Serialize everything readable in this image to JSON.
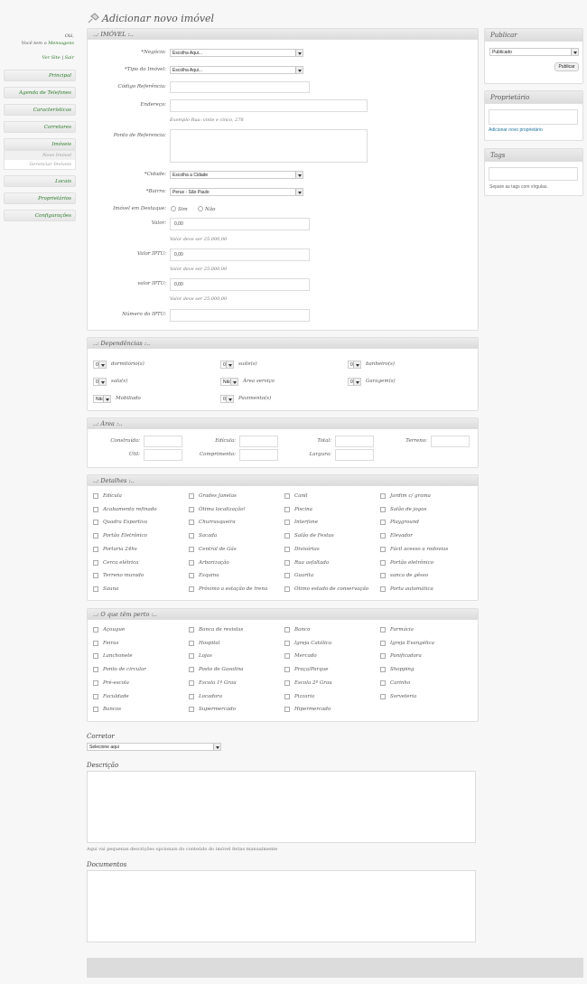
{
  "page_title": "Adicionar novo imóvel",
  "sidebar": {
    "greeting": "Olá,",
    "message_prefix": "Você tem o",
    "message_link": "Mensagens",
    "view_site": "Ver Site",
    "separator": "|",
    "logout": "Sair",
    "items": [
      {
        "label": "Principal"
      },
      {
        "label": "Agenda de Telefones"
      },
      {
        "label": "Características"
      },
      {
        "label": "Corretores"
      },
      {
        "label": "Imóveis"
      },
      {
        "label": "Locais"
      },
      {
        "label": "Proprietários"
      },
      {
        "label": "Configurações"
      }
    ],
    "submenu": [
      {
        "label": "Novo Imóvel"
      },
      {
        "label": "Gerenciar Imóveis"
      }
    ]
  },
  "imovel": {
    "header": "..: IMÓVEL :..",
    "negocio_label": "*Negócio:",
    "negocio_value": "Escolha Aqui...",
    "tipo_label": "*Tipo do Imóvel:",
    "tipo_value": "Escolha Aqui...",
    "codigo_label": "Código Referência:",
    "endereco_label": "Endereço:",
    "endereco_hint": "Exemplo Rua: vinte e cinco, 278",
    "ponto_label": "Ponto de Referencia:",
    "cidade_label": "*Cidade:",
    "cidade_value": "Escolha a Cidade",
    "bairro_label": "*Bairro:",
    "bairro_value": "Perus - São Paulo",
    "destaque_label": "Imóvel em Destaque:",
    "destaque_sim": "Sim",
    "destaque_nao": "Não",
    "valor_label": "Valor:",
    "valor_value": "0,00",
    "valor_hint": "Valor deve ser 25.000,00",
    "iptu_label": "Valor IPTU:",
    "iptu_value": "0,00",
    "iptu_hint": "Valor deve ser 25.000,00",
    "iptu2_label": "valor IPTU:",
    "iptu2_value": "0,00",
    "iptu2_hint": "Valor deve ser 25.000,00",
    "numero_iptu_label": "Número do IPTU:"
  },
  "dependencias": {
    "header": "..: Dependências :..",
    "items": [
      {
        "value": "0",
        "label": "dormitório(s)"
      },
      {
        "value": "0",
        "label": "suíte(s)"
      },
      {
        "value": "0",
        "label": "banheiro(s)"
      },
      {
        "value": "0",
        "label": "sala(s)"
      },
      {
        "value": "Não",
        "label": "Área serviço"
      },
      {
        "value": "0",
        "label": "Garagem(s)"
      },
      {
        "value": "Não",
        "label": "Mobiliado"
      },
      {
        "value": "0",
        "label": "Pavimento(s)"
      }
    ]
  },
  "area": {
    "header": "..: Área :..",
    "fields": [
      "Construída:",
      "Edícula:",
      "Total:",
      "Terreno:",
      "Útil:",
      "Comprimento:",
      "Largura:"
    ]
  },
  "detalhes": {
    "header": "..: Detalhes :..",
    "items": [
      "Edícula",
      "Grades Janelas",
      "Canil",
      "Jardim c/ grama",
      "Acabamento refinado",
      "Ótima localização!",
      "Piscina",
      "Salão de jogos",
      "Quadra Esportiva",
      "Churrasqueira",
      "Interfone",
      "Playground",
      "Portão Eletrônico",
      "Sacada",
      "Salão de Festas",
      "Elevador",
      "Portaria 24hs",
      "Central de Gás",
      "Divisórias",
      "Fácil acesso a rodovias",
      "Cerca elétrica",
      "Arborização",
      "Rua asfaltada",
      "Portão eletrônico",
      "Terreno murado",
      "Esquina",
      "Guarita",
      "sanca de gêsso",
      "Sauna",
      "Próximo a estação de trena",
      "Ótimo estado de conservação",
      "Porta automática"
    ]
  },
  "perto": {
    "header": "..: O que têm perto :..",
    "items": [
      "Açougue",
      "Banca de revistas",
      "Banco",
      "Farmácia",
      "Feiras",
      "Hospital",
      "Igreja Católica",
      "Igreja Evangélica",
      "Lanchonete",
      "Lojas",
      "Mercado",
      "Panificadora",
      "Ponto de circular",
      "Posto de Gasolina",
      "Praça/Parque",
      "Shopping",
      "Pré-escola",
      "Escola 1º Grau",
      "Escola 2º Grau",
      "Carinho",
      "Faculdade",
      "Locadora",
      "Pizzaria",
      "Sorveteria",
      "Bancos",
      "Supermercado",
      "Hipermercado"
    ]
  },
  "corretor": {
    "label": "Corretor",
    "value": "Selecione aqui"
  },
  "descricao": {
    "label": "Descrição",
    "hint": "Aqui vai pequenas descrições opcionais do conteúdo do imóvel feitas manualmente"
  },
  "documentos": {
    "label": "Documentos"
  },
  "publicar": {
    "header": "Publicar",
    "status": "Publicado",
    "button": "Publicar"
  },
  "proprietario": {
    "header": "Proprietário",
    "link": "Adicionar novo proprietário"
  },
  "tags": {
    "header": "Tags",
    "hint": "Separe as tags com vírgulas."
  }
}
